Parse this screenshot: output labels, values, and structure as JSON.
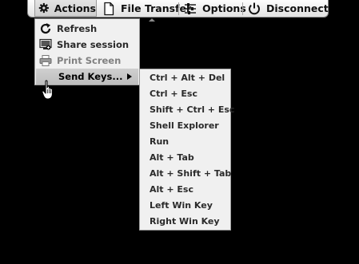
{
  "toolbar": {
    "actions_label": "Actions",
    "file_transfer_label": "File Transfer",
    "options_label": "Options",
    "disconnect_label": "Disconnect"
  },
  "actions_menu": {
    "items": [
      {
        "label": "Refresh",
        "icon": "refresh-icon",
        "enabled": true
      },
      {
        "label": "Share session",
        "icon": "share-session-icon",
        "enabled": true
      },
      {
        "label": "Print Screen",
        "icon": "printer-icon",
        "enabled": false
      },
      {
        "label": "Send Keys...",
        "icon": "",
        "enabled": true,
        "has_submenu": true
      }
    ]
  },
  "send_keys_menu": {
    "items": [
      "Ctrl + Alt + Del",
      "Ctrl + Esc",
      "Shift + Ctrl + Esc",
      "Shell Explorer",
      "Run",
      "Alt + Tab",
      "Alt + Shift + Tab",
      "Alt + Esc",
      "Left Win Key",
      "Right Win Key"
    ]
  }
}
